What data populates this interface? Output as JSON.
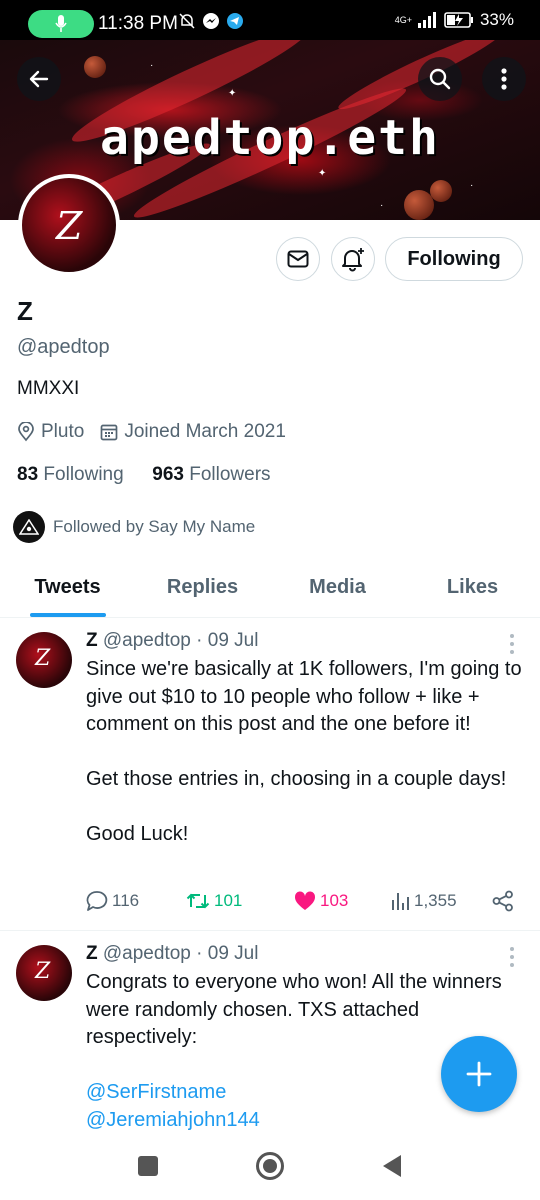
{
  "status_bar": {
    "time": "11:38 PM",
    "network": "4G+",
    "battery": "33%"
  },
  "banner": {
    "text": "apedtop.eth"
  },
  "profile": {
    "avatar_letter": "Z",
    "name": "Z",
    "handle": "@apedtop",
    "bio": "MMXXI",
    "location": "Pluto",
    "joined": "Joined March 2021",
    "following_count": "83",
    "following_label": "Following",
    "followers_count": "963",
    "followers_label": "Followers",
    "followed_by": "Followed by Say My Name",
    "follow_button": "Following"
  },
  "tabs": [
    {
      "label": "Tweets",
      "active": true
    },
    {
      "label": "Replies",
      "active": false
    },
    {
      "label": "Media",
      "active": false
    },
    {
      "label": "Likes",
      "active": false
    }
  ],
  "tweets": [
    {
      "name": "Z",
      "handle": "@apedtop",
      "date": "· 09 Jul",
      "p1": "Since we're basically at 1K followers, I'm going to give out $10 to 10 people who follow + like + comment on this post and the one before it!",
      "p2": "Get those entries in, choosing in a couple days!",
      "p3": "Good Luck!",
      "replies": "116",
      "retweets": "101",
      "likes": "103",
      "views": "1,355"
    },
    {
      "name": "Z",
      "handle": "@apedtop",
      "date": "· 09 Jul",
      "p1": "Congrats to everyone who won! All the winners were randomly chosen. TXS attached respectively:",
      "mention1": "@SerFirstname",
      "mention2": "@Jeremiahjohn144"
    }
  ],
  "colors": {
    "accent": "#1d9bf0",
    "retweet": "#00ba7c",
    "like": "#f91880",
    "muted": "#536471"
  }
}
